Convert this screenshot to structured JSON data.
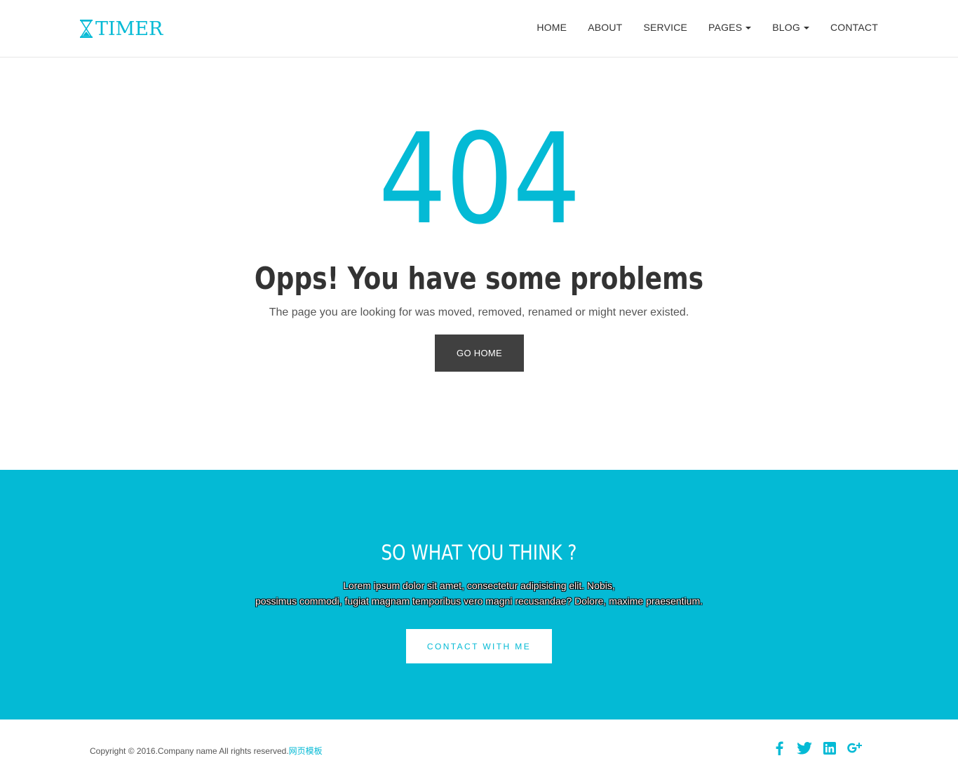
{
  "brand": {
    "name": "TIMER",
    "color": "#04bad5"
  },
  "nav": {
    "items": [
      {
        "label": "HOME",
        "dropdown": false
      },
      {
        "label": "ABOUT",
        "dropdown": false
      },
      {
        "label": "SERVICE",
        "dropdown": false
      },
      {
        "label": "PAGES",
        "dropdown": true
      },
      {
        "label": "BLOG",
        "dropdown": true
      },
      {
        "label": "CONTACT",
        "dropdown": false
      }
    ]
  },
  "error": {
    "code": "404",
    "title": "Opps! You have some problems",
    "subtitle": "The page you are looking for was moved, removed, renamed or might never existed.",
    "button_label": "GO HOME"
  },
  "cta": {
    "title": "SO WHAT YOU THINK ?",
    "text_line1": "Lorem ipsum dolor sit amet, consectetur adipisicing elit.  Nobis,",
    "text_line2": "possimus commodi, fugiat magnam temporibus vero magni recusandae? Dolore, maxime praesentium.",
    "button_label": "CONTACT WITH ME",
    "background": "#04bad5"
  },
  "footer": {
    "copyright": "Copyright © 2016.Company name All rights reserved.",
    "link_text": "网页模板",
    "social": [
      "facebook-icon",
      "twitter-icon",
      "linkedin-icon",
      "google-plus-icon"
    ]
  },
  "colors": {
    "accent": "#04bad5",
    "button_dark": "#404040",
    "text": "#333333"
  }
}
